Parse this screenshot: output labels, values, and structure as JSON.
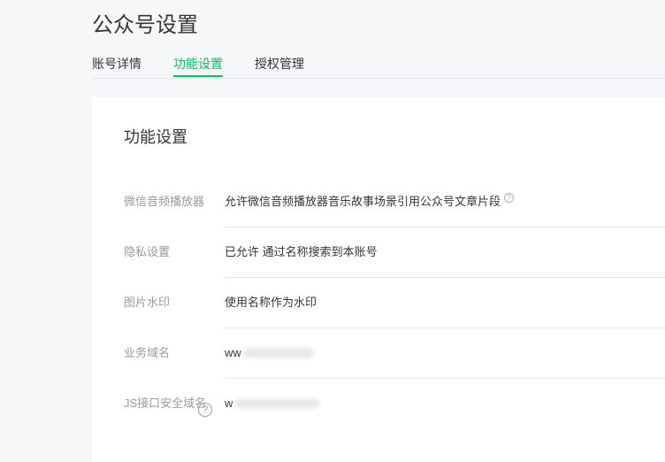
{
  "header": {
    "title": "公众号设置"
  },
  "tabs": [
    {
      "label": "账号详情",
      "active": false
    },
    {
      "label": "功能设置",
      "active": true
    },
    {
      "label": "授权管理",
      "active": false
    }
  ],
  "card": {
    "title": "功能设置",
    "rows": [
      {
        "label": "微信音频播放器",
        "value": "允许微信音频播放器音乐故事场景引用公众号文章片段"
      },
      {
        "label": "隐私设置",
        "value": "已允许 通过名称搜索到本账号"
      },
      {
        "label": "图片水印",
        "value": "使用名称作为水印"
      },
      {
        "label": "业务域名",
        "value": "ww"
      },
      {
        "label": "JS接口安全域名",
        "value": "w"
      }
    ]
  },
  "colors": {
    "accent": "#07c160",
    "label": "#9a9a9a",
    "text": "#353535",
    "divider": "#e4e8eb",
    "background": "#f6f7f9"
  },
  "icons": {
    "help": "question-circle-icon"
  }
}
